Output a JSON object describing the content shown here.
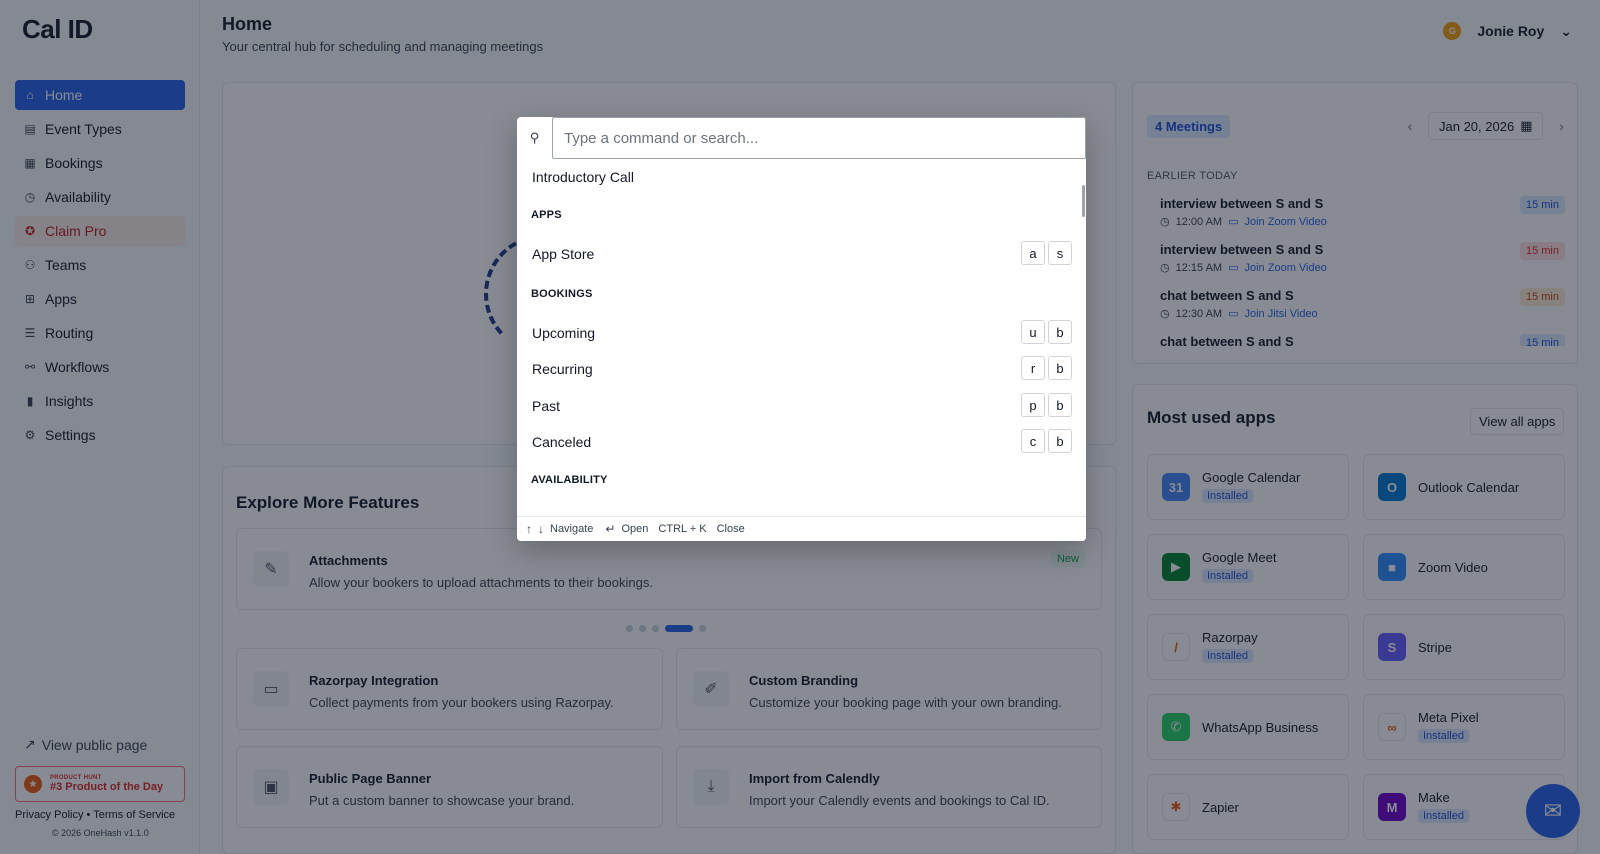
{
  "brand": {
    "logo": "Cal ID"
  },
  "sidebar": {
    "items": [
      {
        "label": "Home",
        "icon": "home-icon"
      },
      {
        "label": "Event Types",
        "icon": "event-types-icon"
      },
      {
        "label": "Bookings",
        "icon": "calendar-icon"
      },
      {
        "label": "Availability",
        "icon": "clock-icon"
      },
      {
        "label": "Claim Pro",
        "icon": "badge-icon"
      },
      {
        "label": "Teams",
        "icon": "users-icon"
      },
      {
        "label": "Apps",
        "icon": "grid-icon"
      },
      {
        "label": "Routing",
        "icon": "routing-icon"
      },
      {
        "label": "Workflows",
        "icon": "workflow-icon"
      },
      {
        "label": "Insights",
        "icon": "chart-icon"
      },
      {
        "label": "Settings",
        "icon": "gear-icon"
      }
    ],
    "public_link": "View public page",
    "product_hunt": {
      "small": "PRODUCT HUNT",
      "big": "#3 Product of the Day"
    },
    "privacy": "Privacy Policy",
    "terms": "Terms of Service",
    "separator": "•",
    "copyright": "© 2026 OneHash v1.1.0"
  },
  "header": {
    "title": "Home",
    "subtitle": "Your central hub for scheduling and managing meetings",
    "user_name": "Jonie Roy",
    "avatar_initial": "G"
  },
  "explore": {
    "title": "Explore More Features",
    "carousel": {
      "title": "Attachments",
      "desc": "Allow your bookers to upload attachments to their bookings.",
      "badge": "New"
    },
    "features": [
      {
        "title": "Razorpay Integration",
        "desc": "Collect payments from your bookers using Razorpay."
      },
      {
        "title": "Custom Branding",
        "desc": "Customize your booking page with your own branding."
      },
      {
        "title": "Public Page Banner",
        "desc": "Put a custom banner to showcase your brand."
      },
      {
        "title": "Import from Calendly",
        "desc": "Import your Calendly events and bookings to Cal ID."
      }
    ]
  },
  "meetings": {
    "badge": "4 Meetings",
    "date": "Jan 20, 2026",
    "section": "EARLIER TODAY",
    "items": [
      {
        "title": "interview between S and S",
        "time": "12:00 AM",
        "link": "Join Zoom Video",
        "duration": "15 min"
      },
      {
        "title": "interview between S and S",
        "time": "12:15 AM",
        "link": "Join Zoom Video",
        "duration": "15 min"
      },
      {
        "title": "chat between S and S",
        "time": "12:30 AM",
        "link": "Join Jitsi Video",
        "duration": "15 min"
      },
      {
        "title": "chat between S and S",
        "time": "",
        "link": "",
        "duration": "15 min"
      }
    ]
  },
  "apps": {
    "title": "Most used apps",
    "view_all": "View all apps",
    "installed_label": "Installed",
    "list": [
      {
        "name": "Google Calendar",
        "installed": true,
        "color": "#4285f4",
        "glyph": "31"
      },
      {
        "name": "Outlook Calendar",
        "installed": false,
        "color": "#0078d4",
        "glyph": "O"
      },
      {
        "name": "Google Meet",
        "installed": true,
        "color": "#00832d",
        "glyph": "▶"
      },
      {
        "name": "Zoom Video",
        "installed": false,
        "color": "#2d8cff",
        "glyph": "■"
      },
      {
        "name": "Razorpay",
        "installed": true,
        "color": "#ffffff",
        "glyph": "/"
      },
      {
        "name": "Stripe",
        "installed": false,
        "color": "#635bff",
        "glyph": "S"
      },
      {
        "name": "WhatsApp Business",
        "installed": false,
        "color": "#25d366",
        "glyph": "✆"
      },
      {
        "name": "Meta Pixel",
        "installed": true,
        "color": "#ffffff",
        "glyph": "∞"
      },
      {
        "name": "Zapier",
        "installed": false,
        "color": "#ffffff",
        "glyph": "✱"
      },
      {
        "name": "Make",
        "installed": true,
        "color": "#6d00cc",
        "glyph": "M"
      }
    ]
  },
  "command_palette": {
    "placeholder": "Type a command or search...",
    "first_item": "Introductory Call",
    "groups": {
      "apps": "APPS",
      "bookings": "BOOKINGS",
      "availability": "AVAILABILITY"
    },
    "items": {
      "app_store": {
        "label": "App Store",
        "keys": [
          "a",
          "s"
        ]
      },
      "upcoming": {
        "label": "Upcoming",
        "keys": [
          "u",
          "b"
        ]
      },
      "recurring": {
        "label": "Recurring",
        "keys": [
          "r",
          "b"
        ]
      },
      "past": {
        "label": "Past",
        "keys": [
          "p",
          "b"
        ]
      },
      "canceled": {
        "label": "Canceled",
        "keys": [
          "c",
          "b"
        ]
      }
    },
    "footer": {
      "navigate": "Navigate",
      "open": "Open",
      "shortcut": "CTRL + K",
      "close": "Close"
    }
  }
}
